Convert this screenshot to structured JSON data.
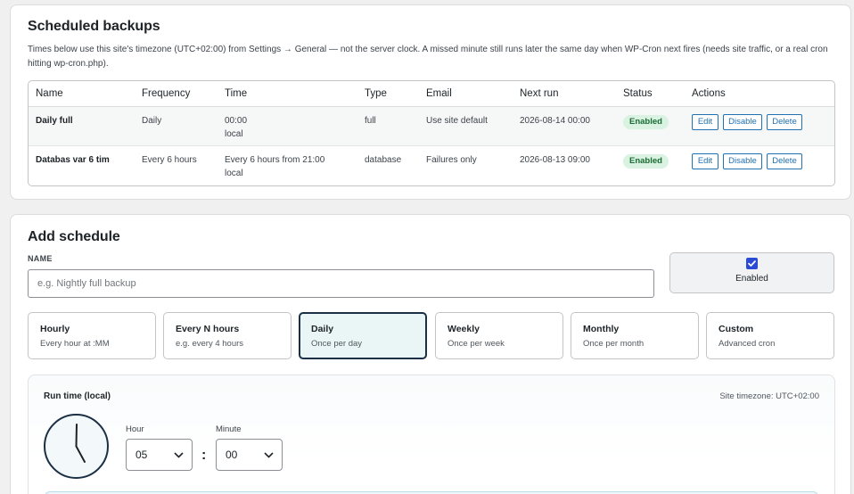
{
  "backups": {
    "title": "Scheduled backups",
    "note": "Times below use this site's timezone (UTC+02:00) from Settings → General — not the server clock. A missed minute still runs later the same day when WP-Cron next fires (needs site traffic, or a real cron hitting wp-cron.php).",
    "columns": [
      "Name",
      "Frequency",
      "Time",
      "Type",
      "Email",
      "Next run",
      "Status",
      "Actions"
    ],
    "rows": [
      {
        "name": "Daily full",
        "frequency": "Daily",
        "time": "00:00",
        "time_note": "local",
        "type": "full",
        "email": "Use site default",
        "next_run": "2026-08-14 00:00",
        "status": "Enabled",
        "edit": "Edit",
        "disable": "Disable",
        "delete": "Delete"
      },
      {
        "name": "Databas var 6 tim",
        "frequency": "Every 6 hours",
        "time": "Every 6 hours from 21:00",
        "time_note": "local",
        "type": "database",
        "email": "Failures only",
        "next_run": "2026-08-13 09:00",
        "status": "Enabled",
        "edit": "Edit",
        "disable": "Disable",
        "delete": "Delete"
      }
    ]
  },
  "add": {
    "title": "Add schedule",
    "name_label": "NAME",
    "name_placeholder": "e.g. Nightly full backup",
    "name_value": "",
    "enabled_label": "Enabled",
    "enabled_checked": true,
    "frequencies": [
      {
        "title": "Hourly",
        "sub": "Every hour at :MM"
      },
      {
        "title": "Every N hours",
        "sub": "e.g. every 4 hours"
      },
      {
        "title": "Daily",
        "sub": "Once per day"
      },
      {
        "title": "Weekly",
        "sub": "Once per week"
      },
      {
        "title": "Monthly",
        "sub": "Once per month"
      },
      {
        "title": "Custom",
        "sub": "Advanced cron"
      }
    ],
    "selected_frequency": "Daily",
    "runtime": {
      "title": "Run time (local)",
      "timezone": "Site timezone: UTC+02:00",
      "hour_label": "Hour",
      "hour_value": "05",
      "minute_label": "Minute",
      "minute_value": "00",
      "separator": ":"
    }
  },
  "colors": {
    "accent": "#2271b1",
    "selected_border": "#1b2f45",
    "selected_bg": "#eaf6f5",
    "badge_bg": "#d9f2e1",
    "badge_text": "#1a6b34",
    "checkbox": "#2c4bd4"
  },
  "icons": [
    "clock-icon",
    "chevron-down-icon",
    "checkmark-icon"
  ]
}
